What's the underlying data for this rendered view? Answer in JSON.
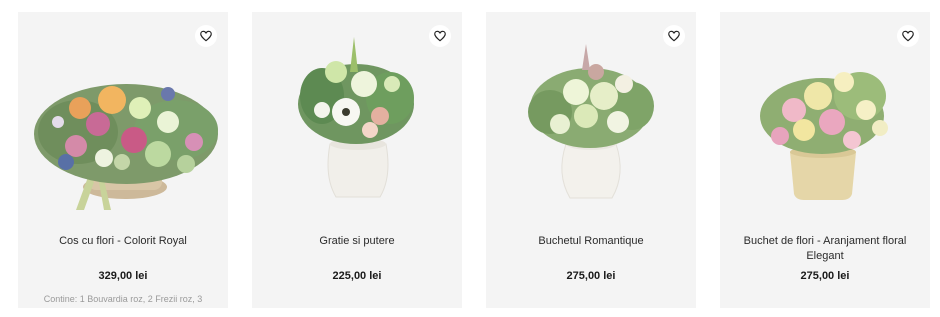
{
  "products": [
    {
      "name": "Cos cu flori - Colorit Royal",
      "price": "329,00 lei",
      "description": "Contine: 1 Bouvardia roz, 2 Frezii roz, 3"
    },
    {
      "name": "Gratie si putere",
      "price": "225,00 lei",
      "description": ""
    },
    {
      "name": "Buchetul Romantique",
      "price": "275,00 lei",
      "description": ""
    },
    {
      "name": "Buchet de flori - Aranjament floral Elegant",
      "price": "275,00 lei",
      "description": ""
    }
  ],
  "icons": {
    "favorite": "heart-outline-icon"
  },
  "colors": {
    "card_bg": "#f4f4f4",
    "text": "#2b2b2b",
    "muted": "#9a9a9a"
  }
}
